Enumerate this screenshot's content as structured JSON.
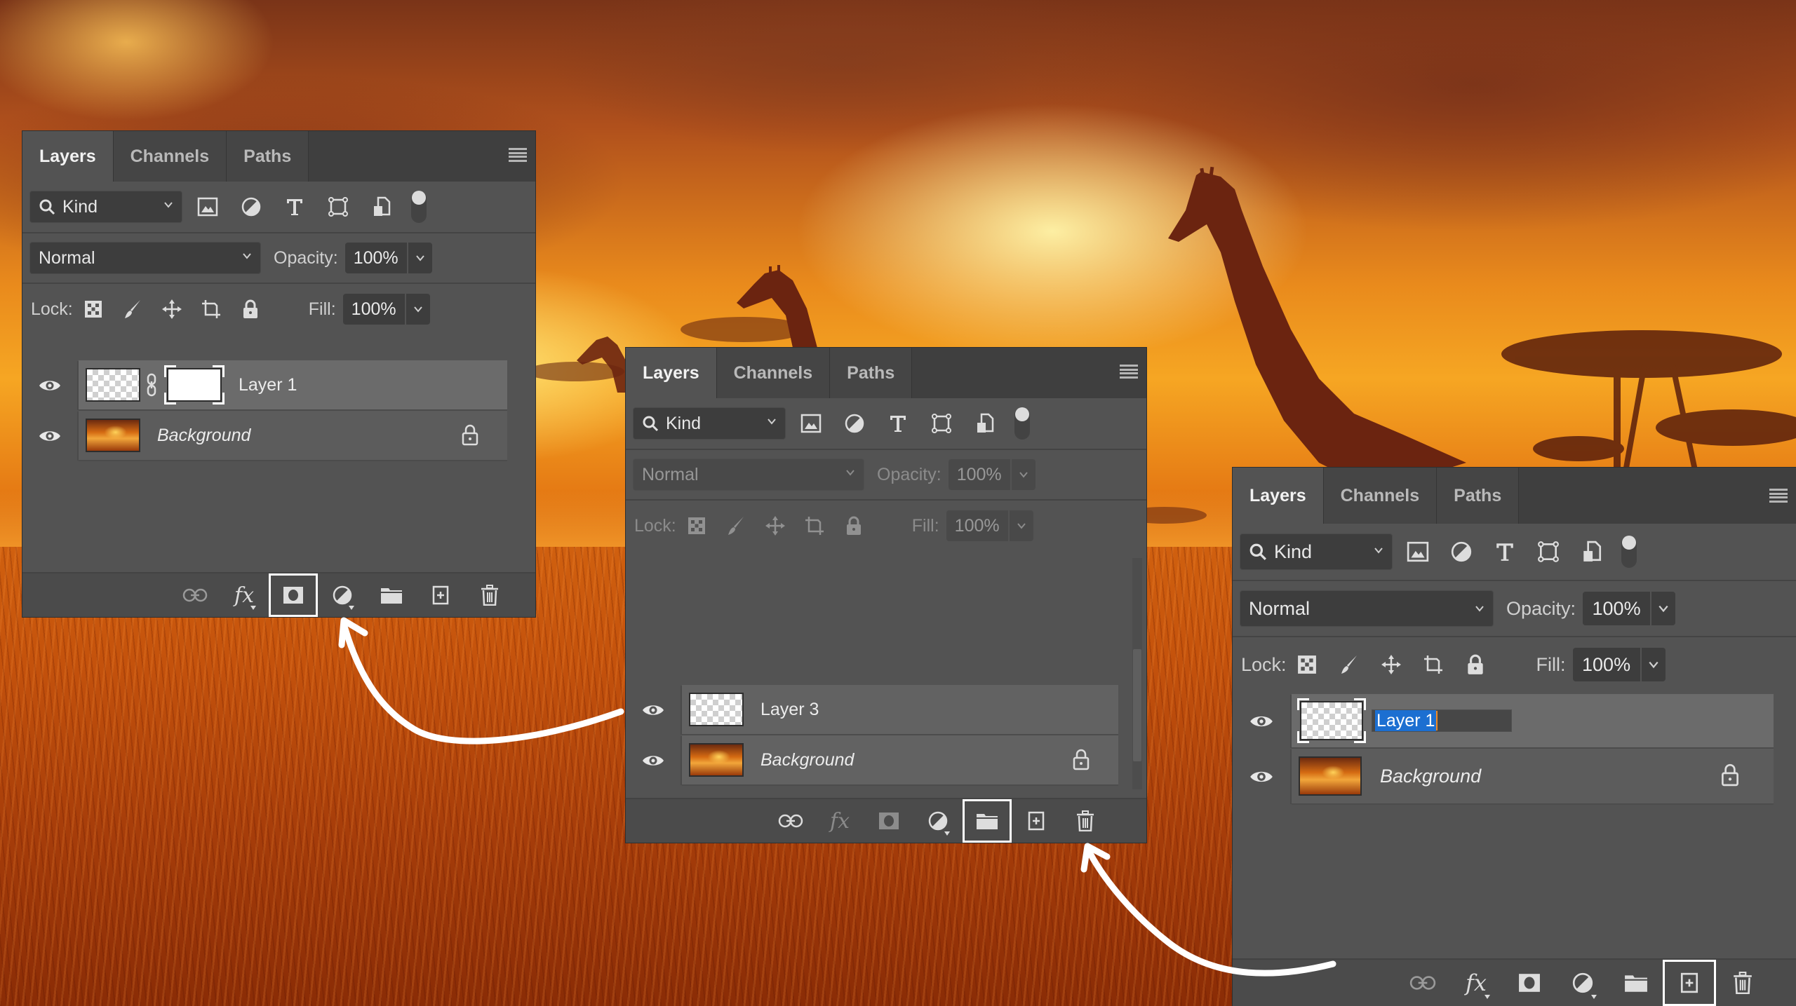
{
  "scene": {
    "description": "Giraffes and acacia trees silhouetted against a fiery orange sunset sky over tall savanna grass"
  },
  "panels": [
    {
      "id": "left",
      "tabs": [
        {
          "label": "Layers",
          "active": true
        },
        {
          "label": "Channels",
          "active": false
        },
        {
          "label": "Paths",
          "active": false
        }
      ],
      "filter": {
        "kind_label": "Kind",
        "icons": [
          "image-filter-icon",
          "adjustment-filter-icon",
          "type-filter-icon",
          "shape-filter-icon",
          "smart-object-filter-icon"
        ]
      },
      "blend_mode": "Normal",
      "opacity_label": "Opacity:",
      "opacity": "100%",
      "lock_label": "Lock:",
      "fill_label": "Fill:",
      "fill": "100%",
      "controls_enabled": true,
      "layers": [
        {
          "name": "Layer 1",
          "visible": true,
          "selected": true,
          "thumb": "transparent",
          "has_mask": true,
          "locked": false,
          "italic": false
        },
        {
          "name": "Background",
          "visible": true,
          "selected": false,
          "thumb": "photo",
          "has_mask": false,
          "locked": true,
          "italic": true
        }
      ],
      "footer_highlight": "add-mask"
    },
    {
      "id": "middle",
      "tabs": [
        {
          "label": "Layers",
          "active": true
        },
        {
          "label": "Channels",
          "active": false
        },
        {
          "label": "Paths",
          "active": false
        }
      ],
      "filter": {
        "kind_label": "Kind"
      },
      "blend_mode": "Normal",
      "opacity_label": "Opacity:",
      "opacity": "100%",
      "lock_label": "Lock:",
      "fill_label": "Fill:",
      "fill": "100%",
      "controls_enabled": false,
      "layers": [
        {
          "name": "Layer 3",
          "visible": true,
          "selected": false,
          "thumb": "transparent",
          "has_mask": false,
          "locked": false,
          "italic": false
        },
        {
          "name": "Background",
          "visible": true,
          "selected": false,
          "thumb": "photo",
          "has_mask": false,
          "locked": true,
          "italic": true
        }
      ],
      "footer_highlight": "new-group"
    },
    {
      "id": "right",
      "tabs": [
        {
          "label": "Layers",
          "active": true
        },
        {
          "label": "Channels",
          "active": false
        },
        {
          "label": "Paths",
          "active": false
        }
      ],
      "filter": {
        "kind_label": "Kind"
      },
      "blend_mode": "Normal",
      "opacity_label": "Opacity:",
      "opacity": "100%",
      "lock_label": "Lock:",
      "fill_label": "Fill:",
      "fill": "100%",
      "controls_enabled": true,
      "layers": [
        {
          "name": "Layer 1",
          "visible": true,
          "selected": true,
          "thumb": "transparent",
          "has_mask": false,
          "locked": false,
          "italic": false,
          "renaming": true
        },
        {
          "name": "Background",
          "visible": true,
          "selected": false,
          "thumb": "photo",
          "has_mask": false,
          "locked": true,
          "italic": true
        }
      ],
      "footer_highlight": "new-layer"
    }
  ],
  "footer_buttons": [
    {
      "id": "link",
      "icon": "link-layers-icon"
    },
    {
      "id": "fx",
      "icon": "fx-icon"
    },
    {
      "id": "add-mask",
      "icon": "add-mask-icon"
    },
    {
      "id": "adjustment",
      "icon": "adjustment-layer-icon"
    },
    {
      "id": "new-group",
      "icon": "folder-icon"
    },
    {
      "id": "new-layer",
      "icon": "new-layer-icon"
    },
    {
      "id": "delete",
      "icon": "trash-icon"
    }
  ],
  "colors": {
    "panel_bg": "#535353",
    "tabbar_bg": "#3f3f3f",
    "selected_row": "#6b6b6b",
    "rename_highlight": "#1c6fd1",
    "highlight_box": "#ffffff",
    "arrow": "#ffffff"
  }
}
